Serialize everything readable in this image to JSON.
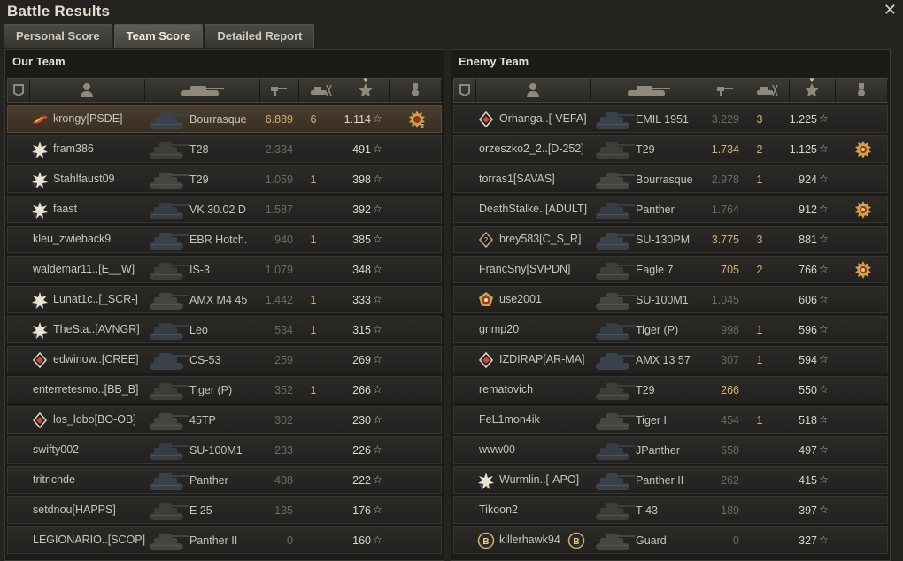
{
  "window": {
    "title": "Battle Results",
    "close_label": "✕"
  },
  "tabs": [
    {
      "label": "Personal Score",
      "active": false
    },
    {
      "label": "Team Score",
      "active": true
    },
    {
      "label": "Detailed Report",
      "active": false
    }
  ],
  "our_team": {
    "title": "Our Team",
    "players": [
      {
        "name": "krongy[PSDE]",
        "badge": "flame-rank-icon",
        "tank": "Bourrasque",
        "damage": "6.889",
        "kills": "6",
        "xp": "1.114",
        "medal": "medal-2-icon",
        "highlight": true,
        "damage_hi": true
      },
      {
        "name": "fram386",
        "badge": "star-rank-icon",
        "tank": "T28",
        "damage": "2.334",
        "kills": "",
        "xp": "491",
        "medal": ""
      },
      {
        "name": "Stahlfaust09",
        "badge": "star-rank-icon",
        "tank": "T29",
        "damage": "1.059",
        "kills": "1",
        "xp": "398",
        "medal": ""
      },
      {
        "name": "faast",
        "badge": "star-rank-icon",
        "tank": "VK 30.02 D",
        "damage": "1.587",
        "kills": "",
        "xp": "392",
        "medal": ""
      },
      {
        "name": "kleu_zwieback9",
        "badge": "",
        "tank": "EBR Hotch.",
        "damage": "940",
        "kills": "1",
        "xp": "385",
        "medal": ""
      },
      {
        "name": "waldemar11..[E__W]",
        "badge": "",
        "tank": "IS-3",
        "damage": "1.079",
        "kills": "",
        "xp": "348",
        "medal": ""
      },
      {
        "name": "Lunat1c..[_SCR-]",
        "badge": "star-rank-icon",
        "tank": "AMX M4 45",
        "damage": "1.442",
        "kills": "1",
        "xp": "333",
        "medal": ""
      },
      {
        "name": "TheSta..[AVNGR]",
        "badge": "star-rank-icon",
        "tank": "Leo",
        "damage": "534",
        "kills": "1",
        "xp": "315",
        "medal": ""
      },
      {
        "name": "edwinow..[CREE]",
        "badge": "diamond-rank-icon",
        "tank": "CS-53",
        "damage": "259",
        "kills": "",
        "xp": "269",
        "medal": ""
      },
      {
        "name": "enterretesmo..[BB_B]",
        "badge": "",
        "tank": "Tiger (P)",
        "damage": "352",
        "kills": "1",
        "xp": "266",
        "medal": ""
      },
      {
        "name": "los_lobo[BO-OB]",
        "badge": "diamond-rank-icon",
        "tank": "45TP",
        "damage": "302",
        "kills": "",
        "xp": "230",
        "medal": ""
      },
      {
        "name": "swifty002",
        "badge": "",
        "tank": "SU-100M1",
        "damage": "233",
        "kills": "",
        "xp": "226",
        "medal": ""
      },
      {
        "name": "tritrichde",
        "badge": "",
        "tank": "Panther",
        "damage": "408",
        "kills": "",
        "xp": "222",
        "medal": ""
      },
      {
        "name": "setdnou[HAPPS]",
        "badge": "",
        "tank": "E 25",
        "damage": "135",
        "kills": "",
        "xp": "176",
        "medal": ""
      },
      {
        "name": "LEGIONARIO..[SCOP]",
        "badge": "",
        "tank": "Panther II",
        "damage": "0",
        "kills": "",
        "xp": "160",
        "medal": ""
      }
    ]
  },
  "enemy_team": {
    "title": "Enemy Team",
    "players": [
      {
        "name": "Orhanga..[-VEFA]",
        "badge": "diamond-rank-icon",
        "tank": "EMIL 1951",
        "damage": "3.229",
        "kills": "3",
        "xp": "1.225",
        "medal": ""
      },
      {
        "name": "orzeszko2_2..[D-252]",
        "badge": "",
        "tank": "T29",
        "damage": "1.734",
        "kills": "2",
        "xp": "1.125",
        "medal": "medal-icon",
        "damage_hi": true
      },
      {
        "name": "torras1[SAVAS]",
        "badge": "",
        "tank": "Bourrasque",
        "damage": "2.978",
        "kills": "1",
        "xp": "924",
        "medal": ""
      },
      {
        "name": "DeathStalke..[ADULT]",
        "badge": "",
        "tank": "Panther",
        "damage": "1.764",
        "kills": "",
        "xp": "912",
        "medal": "medal-icon"
      },
      {
        "name": "brey583[C_S_R]",
        "badge": "diamond2-rank-icon",
        "tank": "SU-130PM",
        "damage": "3.775",
        "kills": "3",
        "xp": "881",
        "medal": "",
        "damage_hi": true
      },
      {
        "name": "FrancSny[SVPDN]",
        "badge": "",
        "tank": "Eagle 7",
        "damage": "705",
        "kills": "2",
        "xp": "766",
        "medal": "medal-icon",
        "damage_hi": true
      },
      {
        "name": "use2001",
        "badge": "pentagon-rank-icon",
        "tank": "SU-100M1",
        "damage": "1.045",
        "kills": "",
        "xp": "606",
        "medal": ""
      },
      {
        "name": "grimp20",
        "badge": "",
        "tank": "Tiger (P)",
        "damage": "998",
        "kills": "1",
        "xp": "596",
        "medal": ""
      },
      {
        "name": "IZDIRAP[AR-MA]",
        "badge": "diamond-rank-icon",
        "tank": "AMX 13 57",
        "damage": "307",
        "kills": "1",
        "xp": "594",
        "medal": ""
      },
      {
        "name": "rematovich",
        "badge": "",
        "tank": "T29",
        "damage": "266",
        "kills": "",
        "xp": "550",
        "medal": "",
        "damage_hi": true
      },
      {
        "name": "FeL1mon4ik",
        "badge": "",
        "tank": "Tiger I",
        "damage": "454",
        "kills": "1",
        "xp": "518",
        "medal": ""
      },
      {
        "name": "www00",
        "badge": "",
        "tank": "JPanther",
        "damage": "658",
        "kills": "",
        "xp": "497",
        "medal": ""
      },
      {
        "name": "Wurmlin..[-APO]",
        "badge": "star-rank-icon",
        "tank": "Panther II",
        "damage": "262",
        "kills": "",
        "xp": "415",
        "medal": ""
      },
      {
        "name": "Tikoon2",
        "badge": "",
        "tank": "T-43",
        "damage": "189",
        "kills": "",
        "xp": "397",
        "medal": ""
      },
      {
        "name": "killerhawk94",
        "badge": "b-rank-icon",
        "tank": "Guard",
        "damage": "0",
        "kills": "",
        "xp": "327",
        "medal": "",
        "suffix_badge": "b-rank-icon"
      }
    ]
  }
}
